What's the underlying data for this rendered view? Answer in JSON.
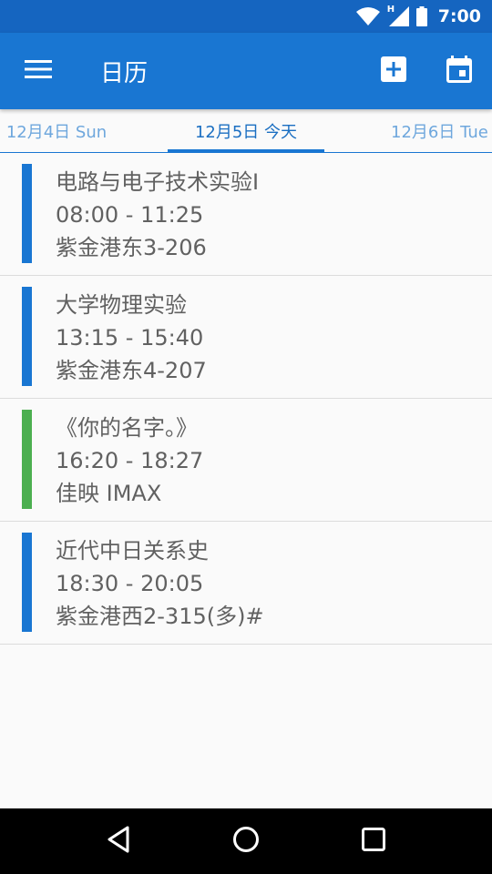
{
  "status_bar": {
    "network_type": "H",
    "time": "7:00",
    "icons": [
      "wifi-icon",
      "cell-signal-icon",
      "battery-icon"
    ]
  },
  "app_bar": {
    "title": "日历",
    "icons": [
      "menu-icon",
      "add-event-icon",
      "calendar-icon"
    ]
  },
  "date_tabs": [
    {
      "label": "12月4日 Sun",
      "selected": false
    },
    {
      "label": "12月5日 今天",
      "selected": true
    },
    {
      "label": "12月6日 Tue",
      "selected": false
    }
  ],
  "events": [
    {
      "title": "电路与电子技术实验I",
      "time": "08:00 - 11:25",
      "location": "紫金港东3-206",
      "color": "#1976d2"
    },
    {
      "title": "大学物理实验",
      "time": "13:15 - 15:40",
      "location": "紫金港东4-207",
      "color": "#1976d2"
    },
    {
      "title": "《你的名字。》",
      "time": "16:20 - 18:27",
      "location": "佳映 IMAX",
      "color": "#4caf50"
    },
    {
      "title": "近代中日关系史",
      "time": "18:30 - 20:05",
      "location": "紫金港西2-315(多)#",
      "color": "#1976d2"
    }
  ],
  "nav_bar": {
    "icons": [
      "back-icon",
      "home-icon",
      "recents-icon"
    ]
  },
  "colors": {
    "status_bar": "#1565c0",
    "app_bar": "#1976d2",
    "accent_blue": "#1976d2",
    "accent_green": "#4caf50"
  }
}
